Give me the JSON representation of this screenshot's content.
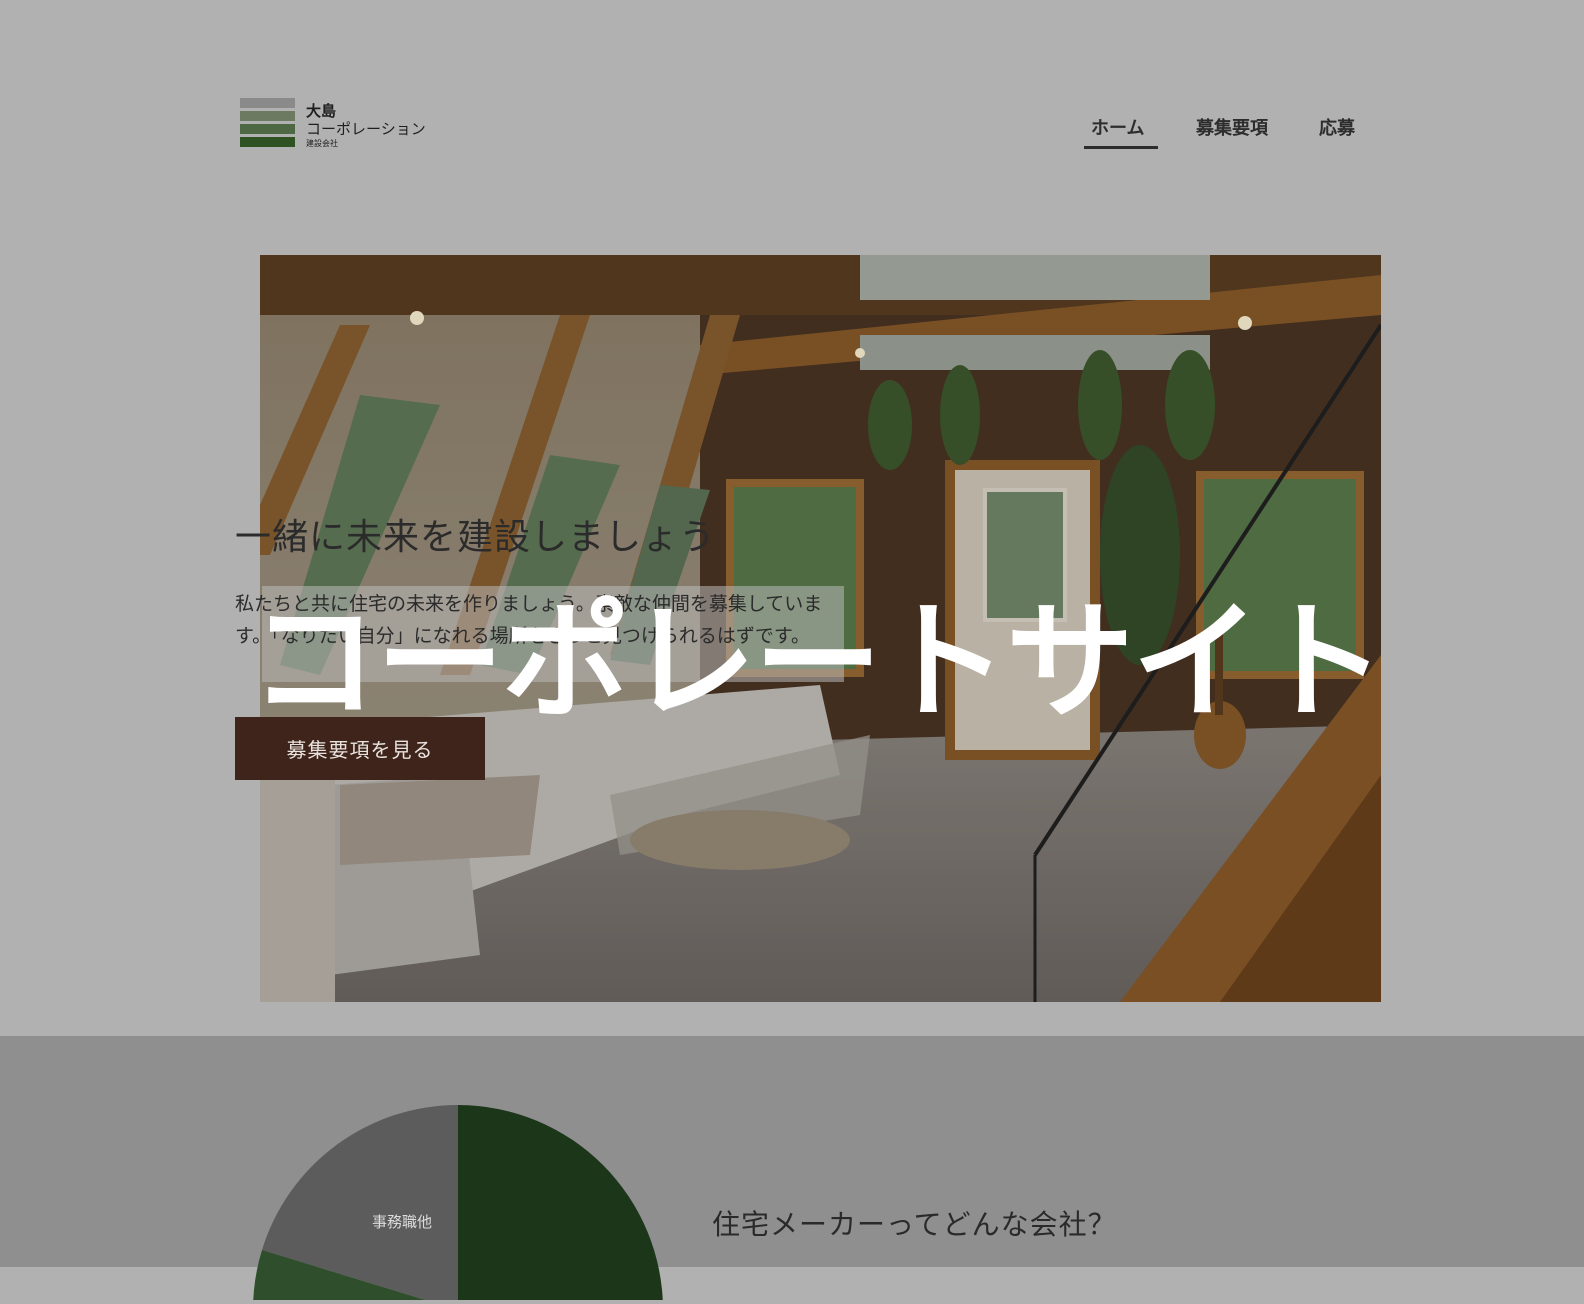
{
  "header": {
    "logo": {
      "name_line1": "大島",
      "name_line2": "コーポレーション",
      "subtitle": "建設会社",
      "stripe_colors": [
        "#8a8a8a",
        "#6c7a62",
        "#4e6844",
        "#2e5222"
      ]
    },
    "nav": [
      {
        "label": "ホーム",
        "active": true
      },
      {
        "label": "募集要項",
        "active": false
      },
      {
        "label": "応募",
        "active": false
      }
    ]
  },
  "hero": {
    "title": "一緒に未来を建設しましょう",
    "text": "私たちと共に住宅の未来を作りましょう。素敵な仲間を募集しています。「なりたい自分」になれる場所をきっと見つけられるはずです。",
    "cta_label": "募集要項を見る",
    "overlay_title": "コーポレートサイト"
  },
  "section": {
    "title": "住宅メーカーってどんな会社？",
    "pie_label": "事務職他"
  },
  "colors": {
    "page_bg": "#b1b1b1",
    "lower_bg": "#8f8f8f",
    "cta_bg": "#3e241a",
    "pie_dark_green": "#1c361a",
    "pie_gray": "#5c5c5c",
    "pie_mid_green": "#2f4f2c"
  }
}
